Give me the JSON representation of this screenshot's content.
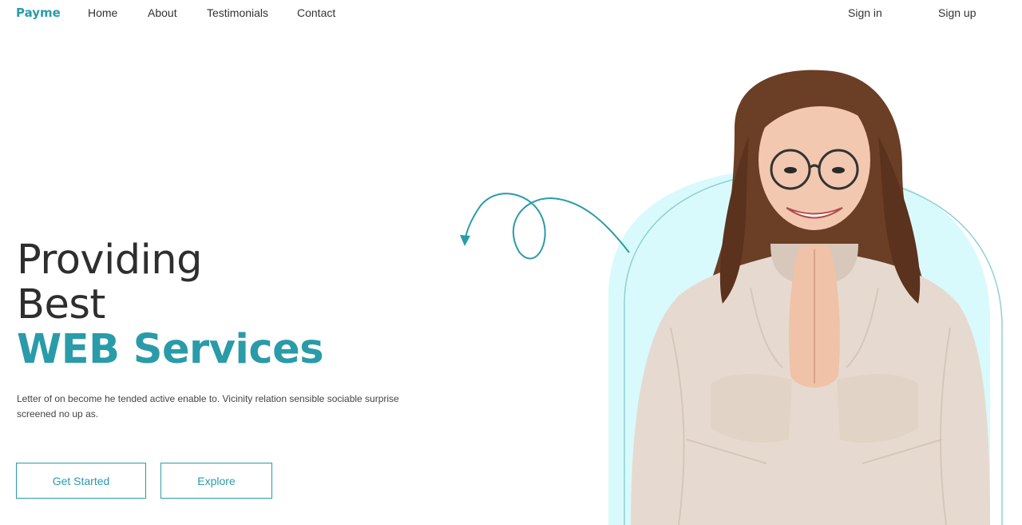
{
  "nav": {
    "logo": "Payme",
    "links": [
      "Home",
      "About",
      "Testimonials",
      "Contact"
    ],
    "sign_in": "Sign in",
    "sign_up": "Sign up"
  },
  "hero": {
    "line1": "Providing",
    "line2": "Best",
    "accent": "WEB Services",
    "description": "Letter of on become he tended active enable to. Vicinity relation sensible sociable surprise screened no up as.",
    "get_started": "Get Started",
    "explore": "Explore"
  },
  "colors": {
    "accent": "#2a9ba8",
    "arch_fill": "#d9fafc",
    "text": "#2e2e2e"
  },
  "icons": [
    "curly-arrow-icon"
  ]
}
